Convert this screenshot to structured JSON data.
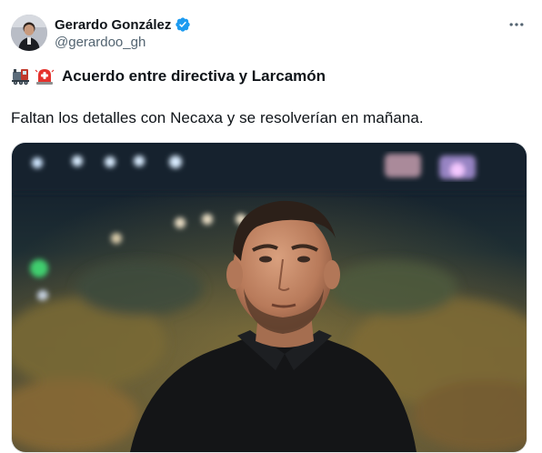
{
  "author": {
    "name": "Gerardo González",
    "handle": "@gerardoo_gh",
    "verified": true
  },
  "menu": {
    "icon": "more-horizontal-icon"
  },
  "tweet": {
    "emojis": [
      "locomotive-emoji",
      "rotating-light-emoji"
    ],
    "headline": "Acuerdo entre directiva y Larcamón",
    "body": "Faltan los detalles con Necaxa y se resolverían en mañana."
  },
  "media": {
    "type": "photo",
    "subject": "stadium-portrait"
  },
  "colors": {
    "text_primary": "#0f1419",
    "text_secondary": "#536471",
    "verified_blue": "#1d9bf0"
  }
}
